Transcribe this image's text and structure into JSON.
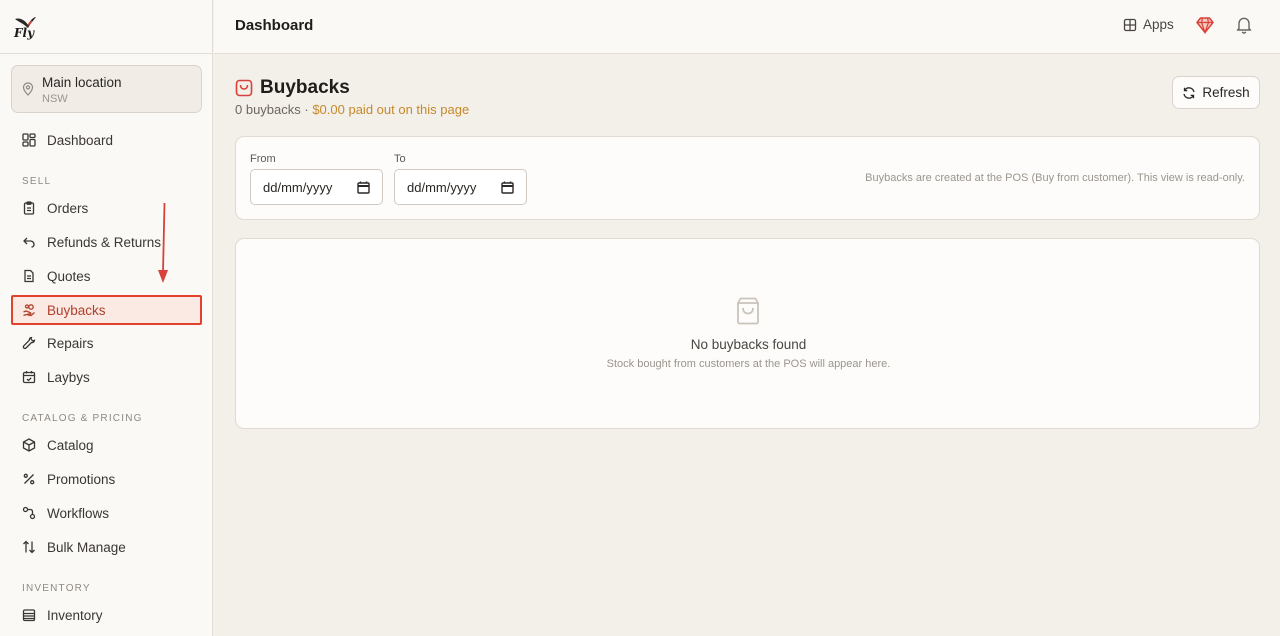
{
  "brand": {
    "name": "Fly"
  },
  "location": {
    "name": "Main location",
    "region": "NSW"
  },
  "sidebar": {
    "dashboard": "Dashboard",
    "sections": {
      "sell": "SELL",
      "catalog": "CATALOG & PRICING",
      "inventory": "INVENTORY"
    },
    "sell_items": [
      "Orders",
      "Refunds & Returns",
      "Quotes",
      "Buybacks",
      "Repairs",
      "Laybys"
    ],
    "catalog_items": [
      "Catalog",
      "Promotions",
      "Workflows",
      "Bulk Manage"
    ],
    "inventory_items": [
      "Inventory"
    ],
    "active_item": "Buybacks"
  },
  "topbar": {
    "title": "Dashboard",
    "apps_label": "Apps"
  },
  "page": {
    "title": "Buybacks",
    "count_text": "0 buybacks · ",
    "paid_text": "$0.00 paid out on this page",
    "refresh_label": "Refresh"
  },
  "filters": {
    "from_label": "From",
    "to_label": "To",
    "from_value": "dd/mm/yyyy",
    "to_value": "dd/mm/yyyy",
    "note": "Buybacks are created at the POS (Buy from customer). This view is read-only."
  },
  "empty_state": {
    "title": "No buybacks found",
    "subtitle": "Stock bought from customers at the POS will appear here."
  },
  "colors": {
    "accent": "#e2412e",
    "paid": "#c6892b",
    "background": "#f3efe9"
  }
}
